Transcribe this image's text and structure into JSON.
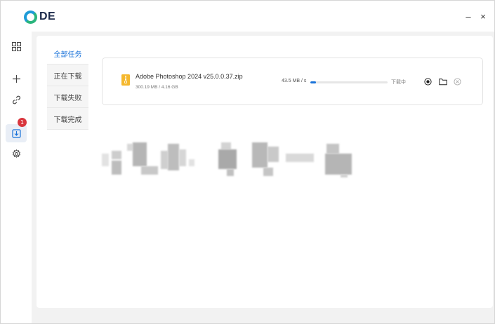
{
  "app": {
    "logo_text": "DE",
    "brand_colors": {
      "ring_blue": "#1e9bd7",
      "ring_green": "#2ab57d",
      "accent": "#1a73d9"
    }
  },
  "window_controls": {
    "minimize_label": "–",
    "close_label": "×"
  },
  "sidebar": {
    "items": [
      {
        "icon": "grid-apps-icon"
      },
      {
        "icon": "plus-icon"
      },
      {
        "icon": "link-icon"
      },
      {
        "icon": "download-icon",
        "badge": "1",
        "active": true
      },
      {
        "icon": "gear-icon"
      }
    ]
  },
  "tabs": [
    {
      "label": "全部任务",
      "active": true
    },
    {
      "label": "正在下载"
    },
    {
      "label": "下载失败"
    },
    {
      "label": "下载完成"
    }
  ],
  "task": {
    "icon": "zip-file-icon",
    "file_name": "Adobe Photoshop 2024 v25.0.0.37.zip",
    "size_text": "300.19 MB / 4.16 GB",
    "speed": "43.5 MB / s",
    "progress_fraction": 0.07,
    "status": "下载中",
    "actions": [
      "pause-icon",
      "folder-icon",
      "cancel-icon"
    ]
  }
}
